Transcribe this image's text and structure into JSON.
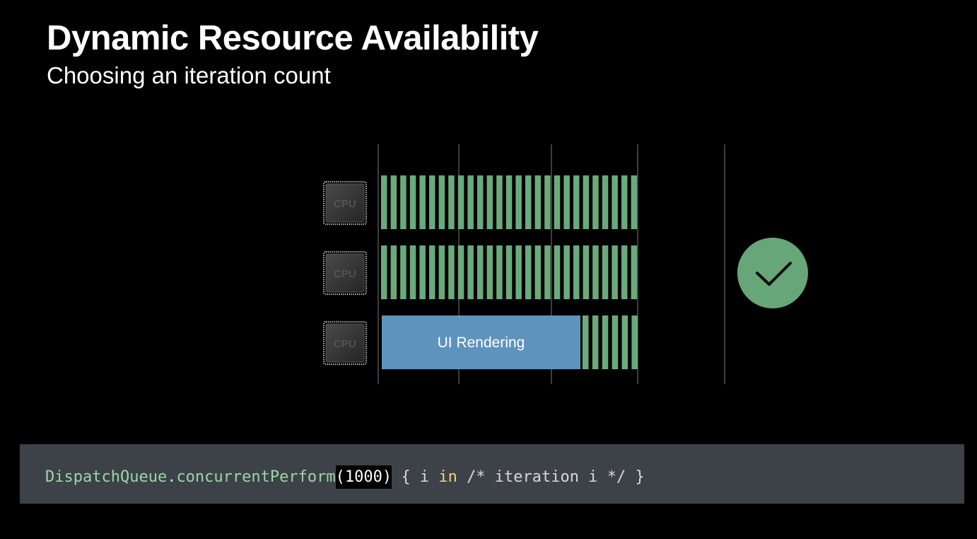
{
  "slide": {
    "title": "Dynamic Resource Availability",
    "subtitle": "Choosing an iteration count"
  },
  "diagram": {
    "cpu_label": "CPU",
    "cpu_rows": [
      {
        "ui_rendering": false,
        "green_stripes": 27
      },
      {
        "ui_rendering": false,
        "green_stripes": 27
      },
      {
        "ui_rendering": true,
        "ui_label": "UI Rendering",
        "green_stripes": 6
      }
    ],
    "status_icon": "checkmark-icon",
    "colors": {
      "work_stripe": "#6aaa7c",
      "ui_rendering": "#5e93bd",
      "check_circle": "#66a679",
      "gridline": "#666666"
    }
  },
  "code": {
    "type_name": "DispatchQueue",
    "dot": ".",
    "method": "concurrentPerform",
    "argument": "(1000)",
    "open": " { i ",
    "keyword": "in",
    "rest": " /* iteration i */ }"
  }
}
